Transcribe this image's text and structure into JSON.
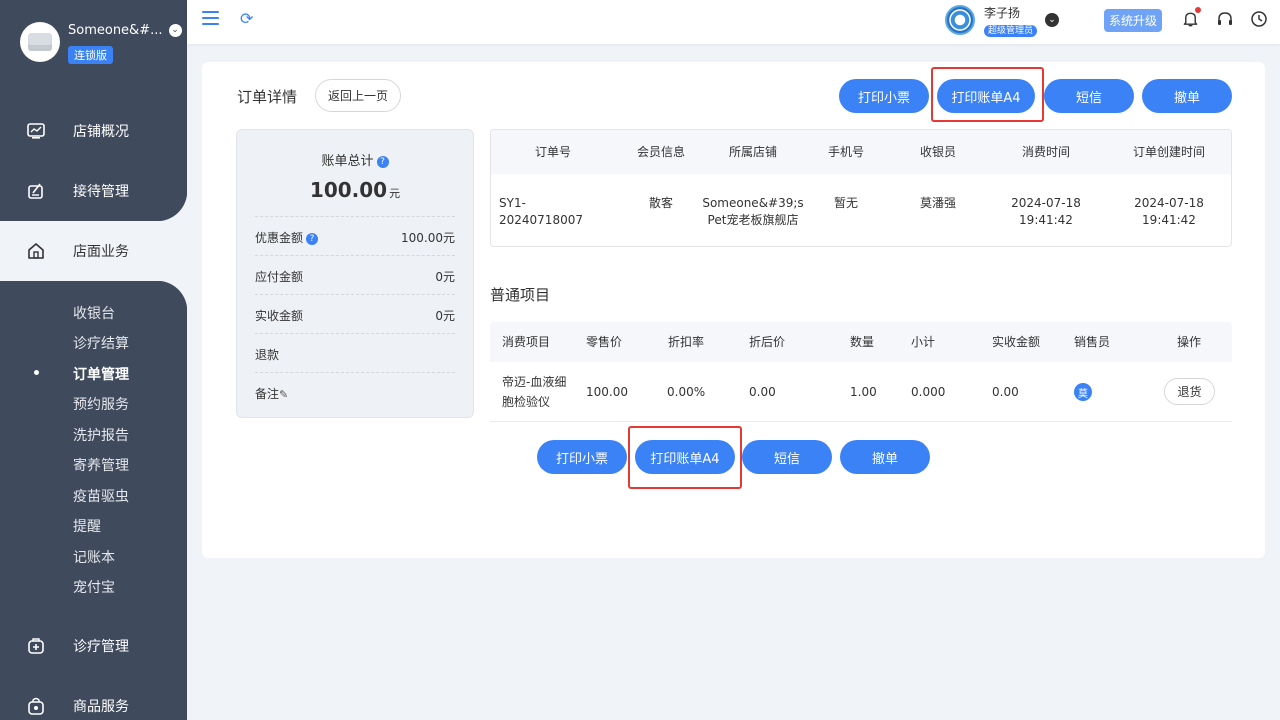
{
  "sidebar": {
    "store_name": "Someone&#...",
    "edition_badge": "连锁版",
    "nav": [
      {
        "label": "店铺概况",
        "icon": "dashboard-icon"
      },
      {
        "label": "接待管理",
        "icon": "reception-icon"
      },
      {
        "label": "店面业务",
        "icon": "home-icon"
      },
      {
        "label": "诊疗管理",
        "icon": "medical-kit-icon"
      },
      {
        "label": "商品服务",
        "icon": "bag-icon"
      }
    ],
    "sub_items": [
      "收银台",
      "诊疗结算",
      "订单管理",
      "预约服务",
      "洗护报告",
      "寄养管理",
      "疫苗驱虫",
      "提醒",
      "记账本",
      "宠付宝"
    ]
  },
  "topbar": {
    "user_name": "李子扬",
    "user_role": "超级管理员",
    "upgrade_label": "系统升级"
  },
  "page": {
    "title": "订单详情",
    "back_label": "返回上一页",
    "actions": {
      "print_receipt": "打印小票",
      "print_a4": "打印账单A4",
      "sms": "短信",
      "cancel": "撤单"
    }
  },
  "summary": {
    "title": "账单总计",
    "total": "100.00",
    "currency": "元",
    "rows": [
      {
        "label": "优惠金额",
        "value": "100.00元"
      },
      {
        "label": "应付金额",
        "value": "0元"
      },
      {
        "label": "实收金额",
        "value": "0元"
      },
      {
        "label": "退款",
        "value": ""
      },
      {
        "label": "备注",
        "value": ""
      }
    ]
  },
  "order_table": {
    "headers": [
      "订单号",
      "会员信息",
      "所属店铺",
      "手机号",
      "收银员",
      "消费时间",
      "订单创建时间"
    ],
    "row": {
      "order_no": "SY1-20240718007",
      "member": "散客",
      "store_line1": "Someone&#39;s",
      "store_line2": "Pet宠老板旗舰店",
      "phone": "暂无",
      "cashier": "莫潘强",
      "consume_date": "2024-07-18",
      "consume_time": "19:41:42",
      "create_date": "2024-07-18",
      "create_time": "19:41:42"
    }
  },
  "items_section": {
    "title": "普通项目",
    "headers": [
      "消费项目",
      "零售价",
      "折扣率",
      "折后价",
      "数量",
      "小计",
      "实收金额",
      "销售员",
      "操作"
    ],
    "row": {
      "name_line1": "帝迈-血液细",
      "name_line2": "胞检验仪",
      "retail_price": "100.00",
      "discount_rate": "0.00%",
      "discounted_price": "0.00",
      "quantity": "1.00",
      "subtotal": "0.000",
      "received": "0.00",
      "seller": "莫",
      "return_label": "退货"
    }
  },
  "colors": {
    "primary": "#3b82f6",
    "sidebar": "#3f4a5c",
    "highlight": "#e53935"
  }
}
